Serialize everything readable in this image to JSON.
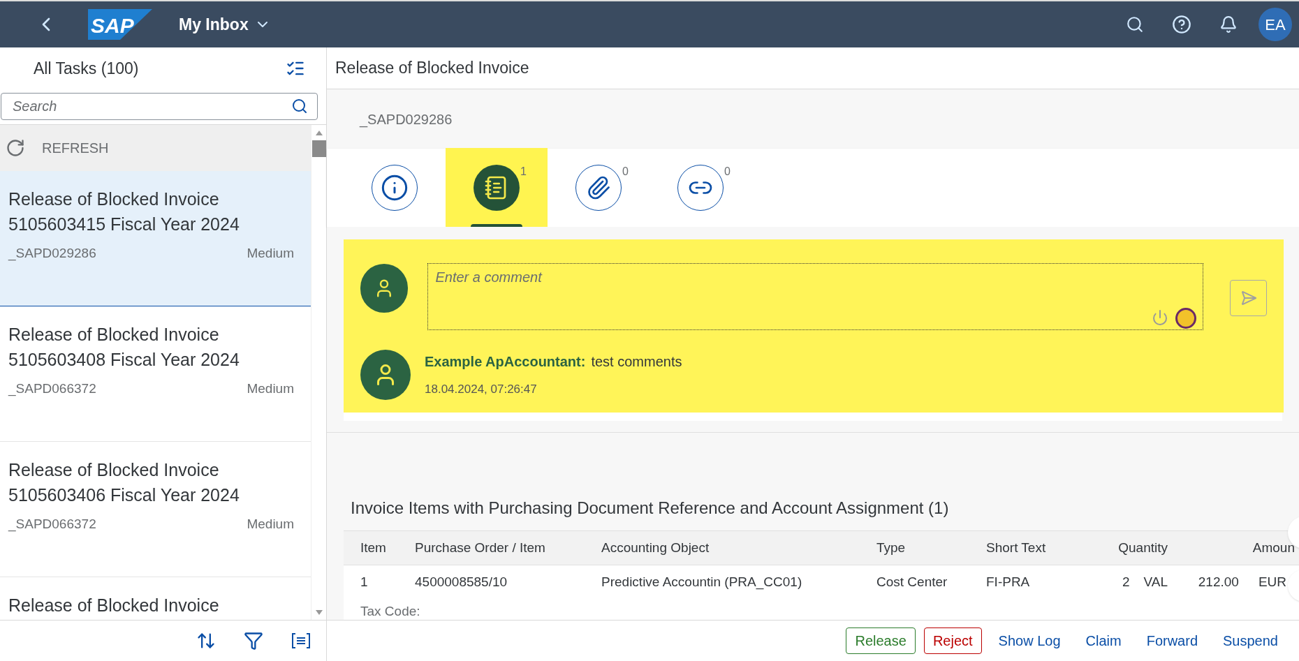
{
  "shell": {
    "logo": "SAP",
    "title": "My Inbox",
    "avatar": "EA"
  },
  "task_list": {
    "title": "All Tasks (100)",
    "search": {
      "placeholder": "Search"
    },
    "refresh": "REFRESH",
    "items": [
      {
        "title_lines": [
          "Release of Blocked Invoice",
          "5105603415 Fiscal Year 2024"
        ],
        "created_by": "_SAPD029286",
        "priority": "Medium",
        "selected": true
      },
      {
        "title_lines": [
          "Release of Blocked Invoice",
          "5105603408 Fiscal Year 2024"
        ],
        "created_by": "_SAPD066372",
        "priority": "Medium",
        "selected": false
      },
      {
        "title_lines": [
          "Release of Blocked Invoice",
          "5105603406 Fiscal Year 2024"
        ],
        "created_by": "_SAPD066372",
        "priority": "Medium",
        "selected": false
      },
      {
        "title_lines": [
          "Release of Blocked Invoice"
        ],
        "selected": false
      }
    ]
  },
  "detail": {
    "title": "Release of Blocked Invoice",
    "header": "_SAPD029286",
    "tabs": [
      {
        "kind": "info",
        "selected": false,
        "highlighted": false
      },
      {
        "kind": "notes",
        "count": "1",
        "selected": true,
        "highlighted": true
      },
      {
        "kind": "attachments",
        "count": "0",
        "selected": false,
        "highlighted": false
      },
      {
        "kind": "links",
        "count": "0",
        "selected": false,
        "highlighted": false
      }
    ],
    "comments": {
      "highlighted": true,
      "input": {
        "placeholder": "Enter a comment"
      },
      "entries": [
        {
          "author": "Example ApAccountant:",
          "text": "test comments",
          "timestamp": "18.04.2024, 07:26:47"
        }
      ]
    },
    "table": {
      "title": "Invoice Items with Purchasing Document Reference and Account Assignment (1)",
      "columns": [
        "Item",
        "Purchase Order / Item",
        "Accounting Object",
        "Type",
        "Short Text",
        "Quantity",
        "Amoun"
      ],
      "rows": [
        {
          "cells": [
            "1",
            "4500008585/10",
            "Predictive Accountin (PRA_CC01)",
            "Cost Center",
            "FI-PRA"
          ],
          "quantity": "2",
          "unit": "VAL",
          "amount": "212.00",
          "currency": "EUR",
          "detail_label": "Tax Code:"
        }
      ]
    }
  },
  "actions": [
    {
      "label": "Release",
      "kind": "positive"
    },
    {
      "label": "Reject",
      "kind": "negative"
    },
    {
      "label": "Show Log",
      "kind": "transparent"
    },
    {
      "label": "Claim",
      "kind": "transparent"
    },
    {
      "label": "Forward",
      "kind": "transparent"
    },
    {
      "label": "Suspend",
      "kind": "transparent"
    }
  ]
}
